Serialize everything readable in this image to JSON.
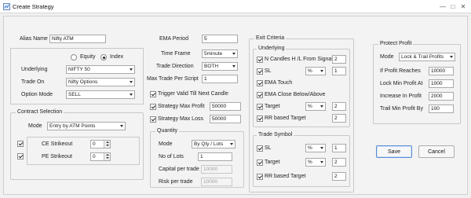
{
  "window": {
    "title": "Create Strategy",
    "controls": {
      "minimize": "—",
      "maximize": "□",
      "close": "✕"
    }
  },
  "alias": {
    "label": "Alias Name",
    "value": "Nifty ATM"
  },
  "instrument": {
    "equity_label": "Equity",
    "index_label": "Index",
    "selected": "Index",
    "underlying": {
      "label": "Underlying",
      "value": "NIFTY 50"
    },
    "trade_on": {
      "label": "Trade On",
      "value": "Nifty Options"
    },
    "option_mode": {
      "label": "Option Mode",
      "value": "SELL"
    }
  },
  "contract": {
    "title": "Contract Selection",
    "mode": {
      "label": "Mode",
      "value": "Entry by ATM Points"
    },
    "ce": {
      "label": "CE Strikeout",
      "value": "0",
      "checked": true
    },
    "pe": {
      "label": "PE Strikeout",
      "value": "0",
      "checked": true
    }
  },
  "params": {
    "ema_period": {
      "label": "EMA Period",
      "value": "5"
    },
    "time_frame": {
      "label": "Time Frame",
      "value": "5minute"
    },
    "trade_direction": {
      "label": "Trade Direction",
      "value": "BOTH"
    },
    "max_trade": {
      "label": "Max Trade Per Script",
      "value": "1"
    },
    "trigger_valid": {
      "label": "Trigger Valid Till Next Candle",
      "checked": true
    },
    "strategy_max_profit": {
      "label": "Strategy Max Profit",
      "value": "50000",
      "checked": true
    },
    "strategy_max_loss": {
      "label": "Strategy Max Loss",
      "value": "50000",
      "checked": true
    }
  },
  "quantity": {
    "title": "Quantity",
    "mode": {
      "label": "Mode",
      "value": "By Qty / Lots"
    },
    "lots": {
      "label": "No of Lots",
      "value": "1"
    },
    "capital": {
      "label": "Capital per trade",
      "value": "10000"
    },
    "risk": {
      "label": "Risk per trade",
      "value": "10000"
    }
  },
  "exit": {
    "title": "Exit Criteria",
    "underlying": {
      "title": "Underlying",
      "n_candles": {
        "label": "N Candles H /L From Signal",
        "value": "2",
        "checked": true
      },
      "sl": {
        "label": "SL",
        "unit": "%",
        "value": "1",
        "checked": true
      },
      "ema_touch": {
        "label": "EMA Touch",
        "checked": true
      },
      "ema_close": {
        "label": "EMA Close Below/Above",
        "checked": true
      },
      "target": {
        "label": "Target",
        "unit": "%",
        "value": "2",
        "checked": true
      },
      "rr_target": {
        "label": "RR based Target",
        "value": "2",
        "checked": true
      }
    },
    "trade_symbol": {
      "title": "Trade Symbol",
      "sl": {
        "label": "SL",
        "unit": "%",
        "value": "1",
        "checked": true
      },
      "target": {
        "label": "Target",
        "unit": "%",
        "value": "2",
        "checked": true
      },
      "rr_target": {
        "label": "RR based Target",
        "value": "2",
        "checked": true
      }
    }
  },
  "protect": {
    "title": "Protect Profit",
    "mode": {
      "label": "Mode",
      "value": "Lock & Trail Profits"
    },
    "reaches": {
      "label": "If Profit Reaches",
      "value": "10000"
    },
    "lock_min": {
      "label": "Lock Min Profit At",
      "value": "1000"
    },
    "increase": {
      "label": "Increase In Profit",
      "value": "2000"
    },
    "trail": {
      "label": "Trail Min Profit By",
      "value": "100"
    }
  },
  "buttons": {
    "save": "Save",
    "cancel": "Cancel"
  }
}
